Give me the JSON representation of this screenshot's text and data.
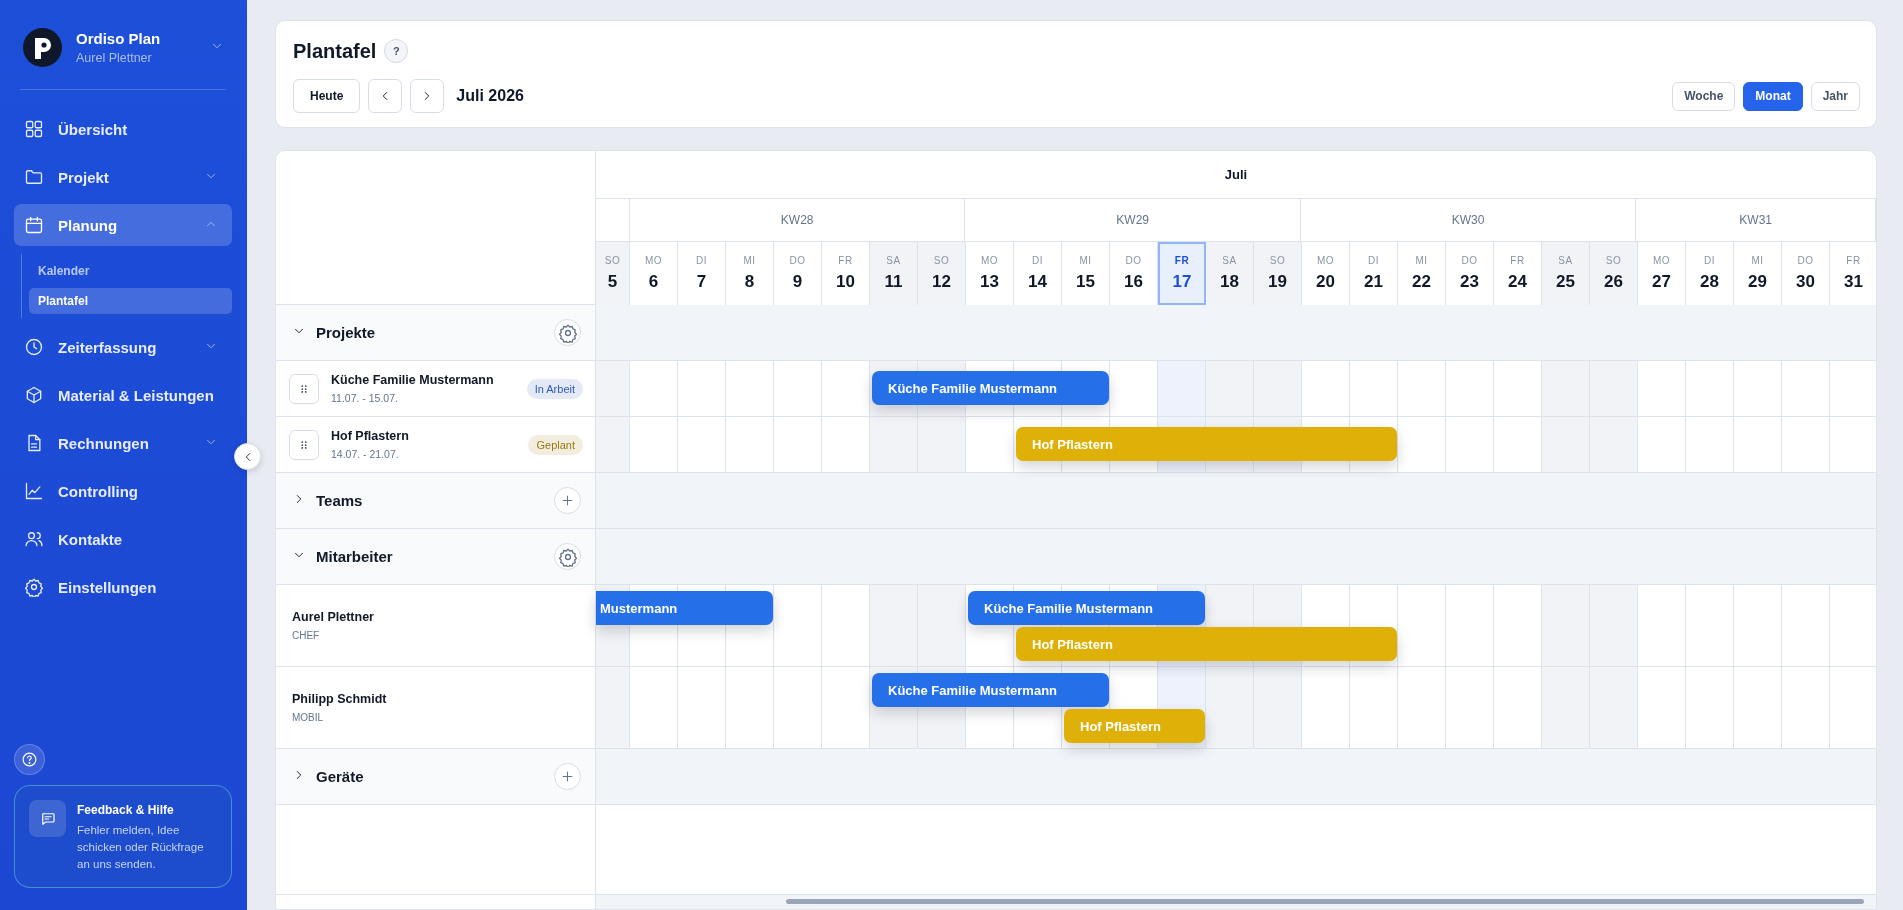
{
  "sidebar": {
    "brand": "Ordiso Plan",
    "user": "Aurel Plettner",
    "nav": [
      {
        "label": "Übersicht",
        "selected": false
      },
      {
        "label": "Projekt",
        "selected": false,
        "expanded": false
      },
      {
        "label": "Planung",
        "selected": true,
        "expanded": true,
        "children": [
          {
            "label": "Kalender",
            "selected": false
          },
          {
            "label": "Plantafel",
            "selected": true
          }
        ]
      },
      {
        "label": "Zeiterfassung",
        "selected": false,
        "expanded": false
      },
      {
        "label": "Material & Leistungen",
        "selected": false
      },
      {
        "label": "Rechnungen",
        "selected": false,
        "expanded": false
      },
      {
        "label": "Controlling",
        "selected": false
      },
      {
        "label": "Kontakte",
        "selected": false
      },
      {
        "label": "Einstellungen",
        "selected": false
      }
    ],
    "feedback": {
      "title": "Feedback & Hilfe",
      "text": "Fehler melden, Idee schicken oder Rückfrage an uns senden."
    }
  },
  "header": {
    "title": "Plantafel",
    "help": "?",
    "today_button": "Heute",
    "period": "Juli 2026",
    "views": [
      {
        "label": "Woche",
        "selected": false
      },
      {
        "label": "Monat",
        "selected": true
      },
      {
        "label": "Jahr",
        "selected": false
      }
    ]
  },
  "planner": {
    "month": "Juli",
    "weeks": [
      {
        "days": [
          {
            "weekday": "SO",
            "day": "5",
            "weekend": true,
            "today": false
          }
        ]
      },
      {
        "label": "KW28",
        "days": [
          {
            "weekday": "MO",
            "day": "6",
            "weekend": false,
            "today": false
          },
          {
            "weekday": "DI",
            "day": "7",
            "weekend": false,
            "today": false
          },
          {
            "weekday": "MI",
            "day": "8",
            "weekend": false,
            "today": false
          },
          {
            "weekday": "DO",
            "day": "9",
            "weekend": false,
            "today": false
          },
          {
            "weekday": "FR",
            "day": "10",
            "weekend": false,
            "today": false
          },
          {
            "weekday": "SA",
            "day": "11",
            "weekend": true,
            "today": false
          },
          {
            "weekday": "SO",
            "day": "12",
            "weekend": true,
            "today": false
          }
        ]
      },
      {
        "label": "KW29",
        "days": [
          {
            "weekday": "MO",
            "day": "13",
            "weekend": false,
            "today": false
          },
          {
            "weekday": "DI",
            "day": "14",
            "weekend": false,
            "today": false
          },
          {
            "weekday": "MI",
            "day": "15",
            "weekend": false,
            "today": false
          },
          {
            "weekday": "DO",
            "day": "16",
            "weekend": false,
            "today": false
          },
          {
            "weekday": "FR",
            "day": "17",
            "weekend": false,
            "today": true
          },
          {
            "weekday": "SA",
            "day": "18",
            "weekend": true,
            "today": false
          },
          {
            "weekday": "SO",
            "day": "19",
            "weekend": true,
            "today": false
          }
        ]
      },
      {
        "label": "KW30",
        "days": [
          {
            "weekday": "MO",
            "day": "20",
            "weekend": false,
            "today": false
          },
          {
            "weekday": "DI",
            "day": "21",
            "weekend": false,
            "today": false
          },
          {
            "weekday": "MI",
            "day": "22",
            "weekend": false,
            "today": false
          },
          {
            "weekday": "DO",
            "day": "23",
            "weekend": false,
            "today": false
          },
          {
            "weekday": "FR",
            "day": "24",
            "weekend": false,
            "today": false
          },
          {
            "weekday": "SA",
            "day": "25",
            "weekend": true,
            "today": false
          },
          {
            "weekday": "SO",
            "day": "26",
            "weekend": true,
            "today": false
          }
        ]
      },
      {
        "label": "KW31",
        "days": [
          {
            "weekday": "MO",
            "day": "27",
            "weekend": false,
            "today": false
          },
          {
            "weekday": "DI",
            "day": "28",
            "weekend": false,
            "today": false
          },
          {
            "weekday": "MI",
            "day": "29",
            "weekend": false,
            "today": false
          },
          {
            "weekday": "DO",
            "day": "30",
            "weekend": false,
            "today": false
          },
          {
            "weekday": "FR",
            "day": "31",
            "weekend": false,
            "today": false
          }
        ]
      }
    ],
    "rows": [
      {
        "kind": "section",
        "title": "Projekte",
        "expanded": true
      },
      {
        "kind": "project",
        "title": "Küche Familie Mustermann",
        "dates": "11.07. - 15.07.",
        "status": "In Arbeit",
        "color": "#2f5cb5",
        "bars": [
          {
            "label": "Küche Familie Mustermann",
            "color": "#2570e8",
            "continued": false
          }
        ]
      },
      {
        "kind": "project",
        "title": "Hof Pflastern",
        "dates": "14.07. - 21.07.",
        "status": "Geplant",
        "color": "#9a7a0c",
        "bars": [
          {
            "label": "Hof Pflastern",
            "color": "#dfb007",
            "continued": false
          }
        ]
      },
      {
        "kind": "section",
        "title": "Teams",
        "expanded": false
      },
      {
        "kind": "section",
        "title": "Mitarbeiter",
        "expanded": true
      },
      {
        "kind": "person",
        "title": "Aurel Plettner",
        "role": "CHEF",
        "bars": [
          {
            "label": "Mustermann",
            "color": "#2570e8",
            "continued": true
          },
          {
            "label": "Küche Familie Mustermann",
            "color": "#2570e8",
            "continued": false
          },
          {
            "label": "Hof Pflastern",
            "color": "#dfb007",
            "continued": false
          }
        ]
      },
      {
        "kind": "person",
        "title": "Philipp Schmidt",
        "role": "MOBIL",
        "bars": [
          {
            "label": "Küche Familie Mustermann",
            "color": "#2570e8",
            "continued": false
          },
          {
            "label": "Hof Pflastern",
            "color": "#dfb007",
            "continued": false
          }
        ]
      },
      {
        "kind": "section",
        "title": "Geräte",
        "expanded": false
      }
    ]
  }
}
